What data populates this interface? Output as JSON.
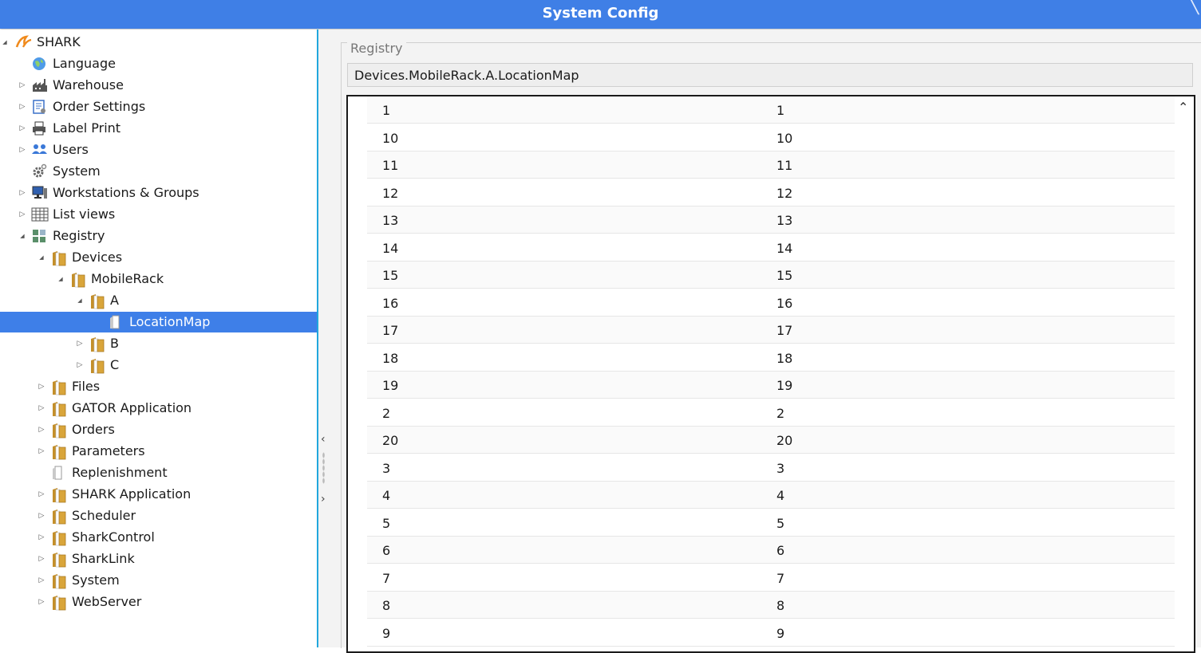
{
  "window": {
    "title": "System Config"
  },
  "tree": [
    {
      "id": "shark",
      "label": "SHARK",
      "icon": "shark-logo-icon",
      "depth": 0,
      "arrow": "expanded"
    },
    {
      "id": "language",
      "label": "Language",
      "icon": "globe-icon",
      "depth": 1,
      "arrow": "none"
    },
    {
      "id": "warehouse",
      "label": "Warehouse",
      "icon": "factory-icon",
      "depth": 1,
      "arrow": "collapsed"
    },
    {
      "id": "order-settings",
      "label": "Order Settings",
      "icon": "document-settings-icon",
      "depth": 1,
      "arrow": "collapsed"
    },
    {
      "id": "label-print",
      "label": "Label Print",
      "icon": "printer-icon",
      "depth": 1,
      "arrow": "collapsed"
    },
    {
      "id": "users",
      "label": "Users",
      "icon": "users-icon",
      "depth": 1,
      "arrow": "collapsed"
    },
    {
      "id": "system",
      "label": "System",
      "icon": "gear-icon",
      "depth": 1,
      "arrow": "none"
    },
    {
      "id": "workstations",
      "label": "Workstations & Groups",
      "icon": "workstation-icon",
      "depth": 1,
      "arrow": "collapsed"
    },
    {
      "id": "list-views",
      "label": "List views",
      "icon": "table-icon",
      "depth": 1,
      "arrow": "collapsed"
    },
    {
      "id": "registry",
      "label": "Registry",
      "icon": "registry-icon",
      "depth": 1,
      "arrow": "expanded"
    },
    {
      "id": "devices",
      "label": "Devices",
      "icon": "folder-icon",
      "depth": 2,
      "arrow": "expanded"
    },
    {
      "id": "mobilerack",
      "label": "MobileRack",
      "icon": "folder-icon",
      "depth": 3,
      "arrow": "expanded"
    },
    {
      "id": "a",
      "label": "A",
      "icon": "folder-icon",
      "depth": 4,
      "arrow": "expanded"
    },
    {
      "id": "locationmap",
      "label": "LocationMap",
      "icon": "file-icon",
      "depth": 5,
      "arrow": "none",
      "selected": true
    },
    {
      "id": "b",
      "label": "B",
      "icon": "folder-icon",
      "depth": 4,
      "arrow": "collapsed"
    },
    {
      "id": "c",
      "label": "C",
      "icon": "folder-icon",
      "depth": 4,
      "arrow": "collapsed"
    },
    {
      "id": "files",
      "label": "Files",
      "icon": "folder-icon",
      "depth": 2,
      "arrow": "collapsed"
    },
    {
      "id": "gator-application",
      "label": "GATOR Application",
      "icon": "folder-icon",
      "depth": 2,
      "arrow": "collapsed"
    },
    {
      "id": "orders",
      "label": "Orders",
      "icon": "folder-icon",
      "depth": 2,
      "arrow": "collapsed"
    },
    {
      "id": "parameters",
      "label": "Parameters",
      "icon": "folder-icon",
      "depth": 2,
      "arrow": "collapsed"
    },
    {
      "id": "replenishment",
      "label": "Replenishment",
      "icon": "file-icon",
      "depth": 2,
      "arrow": "none"
    },
    {
      "id": "shark-application",
      "label": "SHARK Application",
      "icon": "folder-icon",
      "depth": 2,
      "arrow": "collapsed"
    },
    {
      "id": "scheduler",
      "label": "Scheduler",
      "icon": "folder-icon",
      "depth": 2,
      "arrow": "collapsed"
    },
    {
      "id": "sharkcontrol",
      "label": "SharkControl",
      "icon": "folder-icon",
      "depth": 2,
      "arrow": "collapsed"
    },
    {
      "id": "sharklink",
      "label": "SharkLink",
      "icon": "folder-icon",
      "depth": 2,
      "arrow": "collapsed"
    },
    {
      "id": "system-reg",
      "label": "System",
      "icon": "folder-icon",
      "depth": 2,
      "arrow": "collapsed"
    },
    {
      "id": "webserver",
      "label": "WebServer",
      "icon": "folder-icon",
      "depth": 2,
      "arrow": "collapsed"
    }
  ],
  "registry": {
    "group_title": "Registry",
    "path": "Devices.MobileRack.A.LocationMap",
    "rows": [
      {
        "key": "1",
        "value": "1"
      },
      {
        "key": "10",
        "value": "10"
      },
      {
        "key": "11",
        "value": "11"
      },
      {
        "key": "12",
        "value": "12"
      },
      {
        "key": "13",
        "value": "13"
      },
      {
        "key": "14",
        "value": "14"
      },
      {
        "key": "15",
        "value": "15"
      },
      {
        "key": "16",
        "value": "16"
      },
      {
        "key": "17",
        "value": "17"
      },
      {
        "key": "18",
        "value": "18"
      },
      {
        "key": "19",
        "value": "19"
      },
      {
        "key": "2",
        "value": "2"
      },
      {
        "key": "20",
        "value": "20"
      },
      {
        "key": "3",
        "value": "3"
      },
      {
        "key": "4",
        "value": "4"
      },
      {
        "key": "5",
        "value": "5"
      },
      {
        "key": "6",
        "value": "6"
      },
      {
        "key": "7",
        "value": "7"
      },
      {
        "key": "8",
        "value": "8"
      },
      {
        "key": "9",
        "value": "9"
      }
    ]
  },
  "colors": {
    "titlebar": "#3f7fe6",
    "selection": "#3e7fe8",
    "splitter_border": "#22a7dd",
    "folder": "#d9a53a",
    "shark_logo": "#f08a1c"
  }
}
